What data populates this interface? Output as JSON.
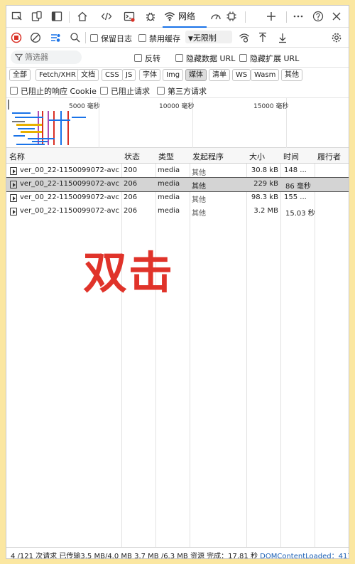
{
  "toolbar": {
    "network_tab_label": "网络"
  },
  "options": {
    "preserve_log": "保留日志",
    "disable_cache": "禁用缓存",
    "throttle_value": "无限制"
  },
  "filter": {
    "placeholder": "筛选器",
    "invert": "反转",
    "hide_data_urls": "隐藏数据 URL",
    "hide_extension_urls": "隐藏扩展 URL"
  },
  "types": [
    "全部",
    "Fetch/XHR",
    "文档",
    "CSS",
    "JS",
    "字体",
    "Img",
    "媒体",
    "清单",
    "WS",
    "Wasm",
    "其他"
  ],
  "blocked": {
    "blocked_cookies": "已阻止的响应 Cookie",
    "blocked_requests": "已阻止请求",
    "third_party": "第三方请求"
  },
  "overview": {
    "ticks": [
      "5000 毫秒",
      "10000 毫秒",
      "15000 毫秒"
    ]
  },
  "table": {
    "headers": {
      "name": "名称",
      "status": "状态",
      "type": "类型",
      "initiator": "发起程序",
      "size": "大小",
      "time": "时间",
      "waterfall": "履行者"
    },
    "rows": [
      {
        "name": "ver_00_22-1150099072-avc-...",
        "status": "200",
        "type": "media",
        "initiator": "其他",
        "size": "30.8 kB",
        "time": "148 ..."
      },
      {
        "name": "ver_00_22-1150099072-avc-...",
        "status": "206",
        "type": "media",
        "initiator": "其他",
        "size": "229 kB",
        "time": "86 毫秒"
      },
      {
        "name": "ver_00_22-1150099072-avc-...",
        "status": "206",
        "type": "media",
        "initiator": "其他",
        "size": "98.3 kB",
        "time": "155 ..."
      },
      {
        "name": "ver_00_22-1150099072-avc-...",
        "status": "206",
        "type": "media",
        "initiator": "其他",
        "size": "3.2 MB",
        "time": "15.03 秒"
      }
    ]
  },
  "overlay_text": "双击",
  "status": {
    "requests": "4 /121 次请求",
    "transferred": "已传输3.5 MB/4.0 MB",
    "resources": "3.7 MB /6.3 MB 资源",
    "finish": "完成：17.81 秒",
    "dcl": "DOMContentLoaded：417"
  },
  "colors": {
    "accent": "#1a73e8",
    "record": "#d93025",
    "overlay": "#e0332a",
    "background": "#fbe7a1"
  }
}
